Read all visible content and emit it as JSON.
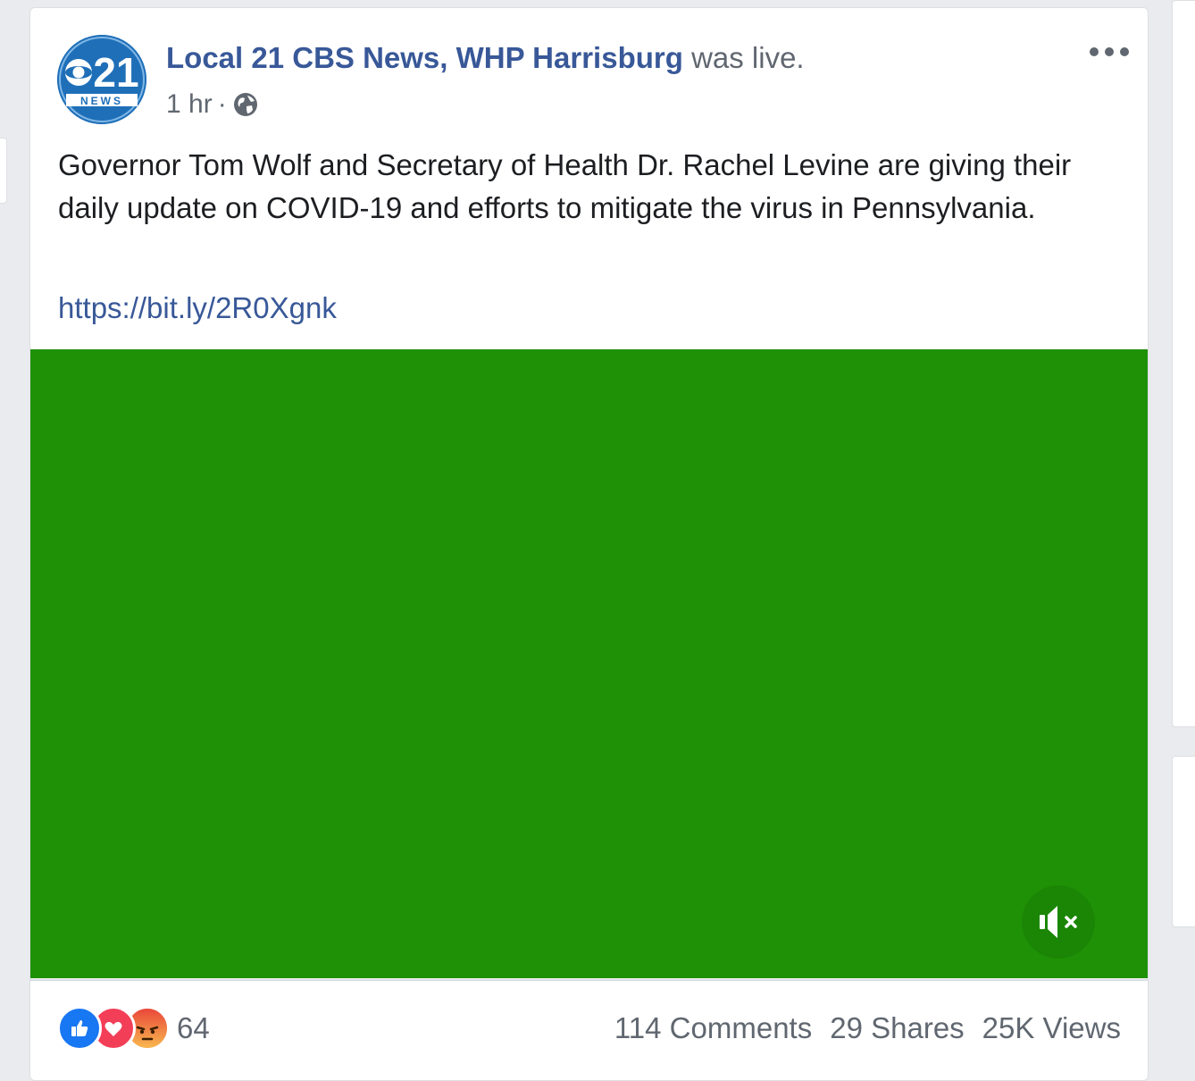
{
  "post": {
    "page_name": "Local 21 CBS News, WHP Harrisburg",
    "action_text": "was live.",
    "timestamp": "1 hr",
    "separator": "·",
    "privacy_icon": "globe-icon",
    "more_icon": "more-options-icon",
    "body_text": "Governor Tom Wolf and Secretary of Health Dr. Rachel Levine are giving their daily update on COVID-19 and efforts to mitigate the virus in Pennsylvania.",
    "link_text": "https://bit.ly/2R0Xgnk",
    "avatar": {
      "logo_number": "21",
      "logo_caption": "NEWS"
    }
  },
  "video": {
    "background_color": "#1f9106",
    "mute_icon": "speaker-muted-icon"
  },
  "footer": {
    "reaction_icons": [
      "like-icon",
      "love-icon",
      "angry-icon"
    ],
    "reaction_count": "64",
    "comments": "114 Comments",
    "shares": "29 Shares",
    "views": "25K Views"
  },
  "colors": {
    "link_blue": "#385898",
    "secondary_text": "#606770",
    "primary_text": "#1c1e21",
    "like_blue": "#1877f2",
    "love_red": "#f33e58",
    "angry_orange": "#f7714c"
  }
}
